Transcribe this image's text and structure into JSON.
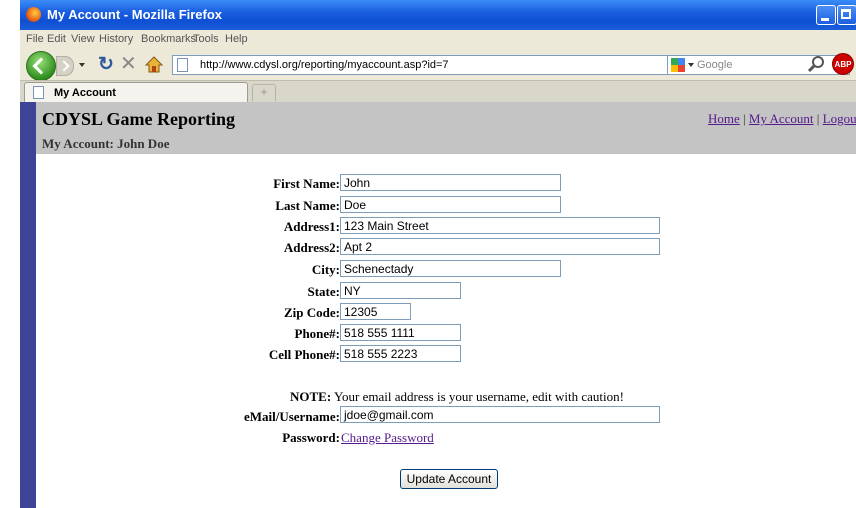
{
  "window": {
    "title": "My Account - Mozilla Firefox"
  },
  "menu": [
    "File",
    "Edit",
    "View",
    "History",
    "Bookmarks",
    "Tools",
    "Help"
  ],
  "address_bar": {
    "url": "http://www.cdysl.org/reporting/myaccount.asp?id=7"
  },
  "search": {
    "placeholder": "Google"
  },
  "tab": {
    "label": "My Account",
    "new_tab": "+"
  },
  "page": {
    "site_title": "CDYSL Game Reporting",
    "subtitle": "My Account: John Doe",
    "links": {
      "home": "Home",
      "sep1": " | ",
      "my_account": "My Account",
      "sep2": " | ",
      "logout": "Logout"
    },
    "form": {
      "first_name": {
        "label": "First Name:",
        "value": "John"
      },
      "last_name": {
        "label": "Last Name:",
        "value": "Doe"
      },
      "address1": {
        "label": "Address1:",
        "value": "123 Main Street"
      },
      "address2": {
        "label": "Address2:",
        "value": "Apt 2"
      },
      "city": {
        "label": "City:",
        "value": "Schenectady"
      },
      "state": {
        "label": "State:",
        "value": "NY"
      },
      "zip": {
        "label": "Zip Code:",
        "value": "12305"
      },
      "phone": {
        "label": "Phone#:",
        "value": "518 555 1111"
      },
      "cell": {
        "label": "Cell Phone#:",
        "value": "518 555 2223"
      },
      "note_label": "NOTE:",
      "note_text": " Your email address is your username, edit with caution!",
      "email": {
        "label": "eMail/Username:",
        "value": "jdoe@gmail.com"
      },
      "password": {
        "label": "Password:",
        "link": "Change Password"
      },
      "submit": "Update Account"
    }
  }
}
